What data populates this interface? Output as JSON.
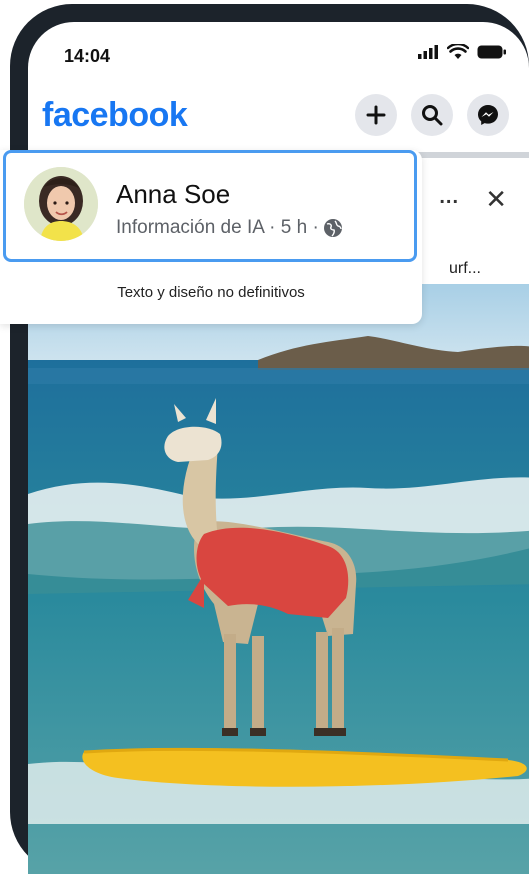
{
  "status_bar": {
    "time": "14:04"
  },
  "header": {
    "logo": "facebook",
    "buttons": [
      "plus-icon",
      "search-icon",
      "messenger-icon"
    ]
  },
  "post": {
    "more_label": "...",
    "close_label": "✕",
    "text_fragment": "urf...",
    "author": "Anna Soe",
    "meta": "Información de IA · 5 h ·",
    "privacy_icon": "globe-icon",
    "disclaimer": "Texto y diseño no definitivos"
  },
  "colors": {
    "brand": "#1877f2",
    "highlight_border": "#4a9bf0"
  }
}
